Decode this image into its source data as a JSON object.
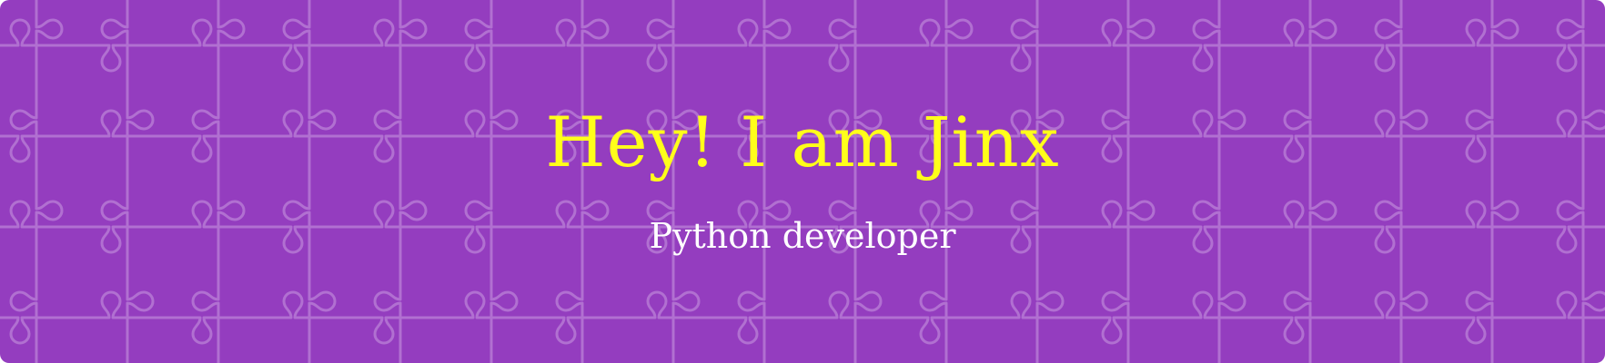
{
  "banner": {
    "title": "Hey! I am Jinx",
    "subtitle": "Python developer",
    "colors": {
      "background": "#943dbf",
      "title": "#ffff1a",
      "subtitle": "#ffffff",
      "pattern_line": "#b679d5"
    },
    "pattern": "puzzle-piece-pattern"
  }
}
